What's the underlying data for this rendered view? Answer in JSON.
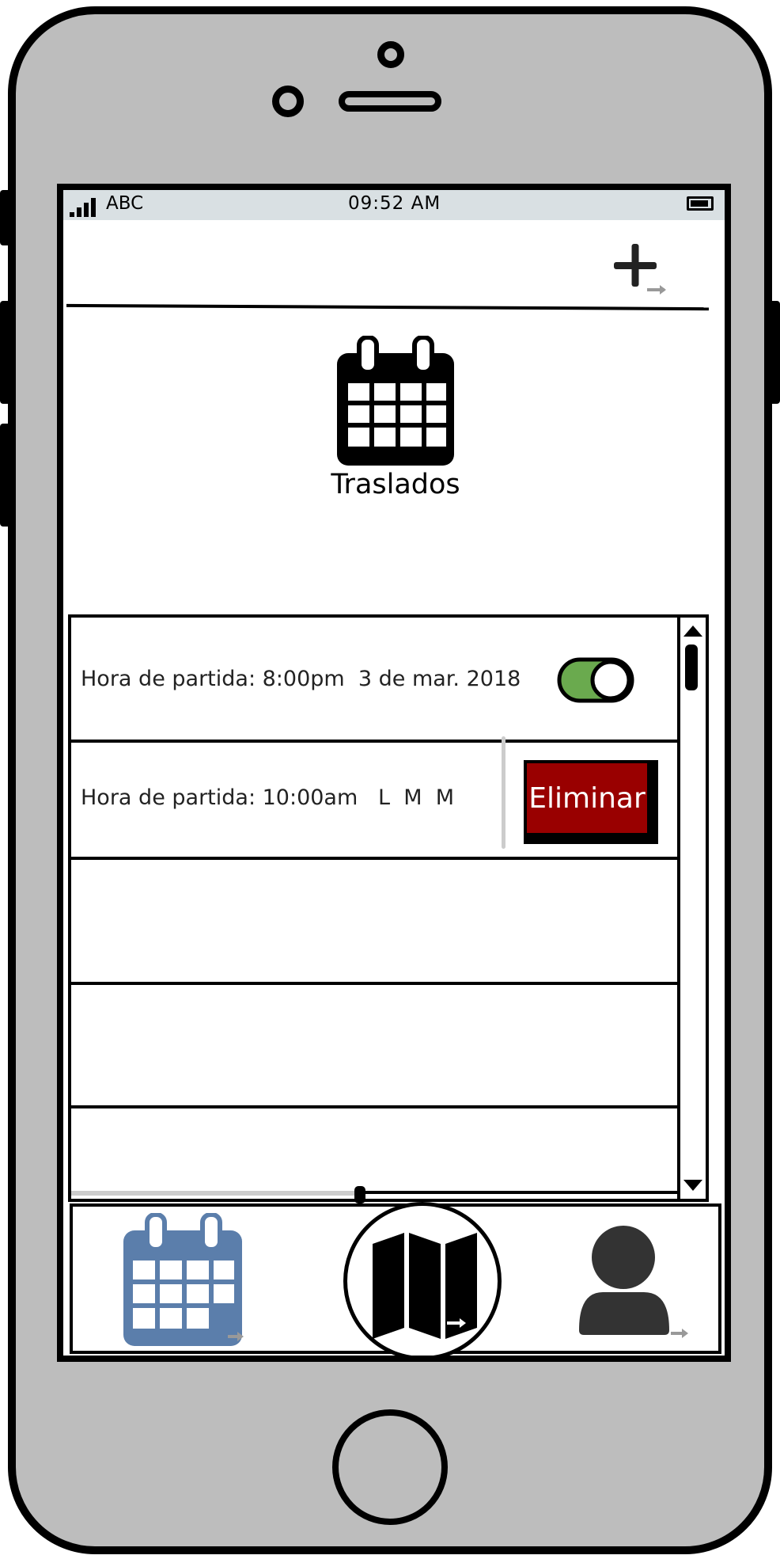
{
  "status_bar": {
    "carrier": "ABC",
    "time": "09:52 AM"
  },
  "header": {
    "add_icon": "plus-icon"
  },
  "page": {
    "title": "Traslados",
    "icon": "calendar-icon"
  },
  "list": {
    "rows": [
      {
        "text": "Hora de partida: 8:00pm  3 de mar. 2018",
        "toggle_on": true
      },
      {
        "text": "Hora de partida: 10:00am   L  M  M",
        "action_label": "Eliminar"
      },
      {
        "text": ""
      },
      {
        "text": ""
      },
      {
        "text": ""
      }
    ]
  },
  "tabbar": {
    "items": [
      {
        "icon": "calendar-icon",
        "active": true
      },
      {
        "icon": "map-icon"
      },
      {
        "icon": "user-icon"
      }
    ]
  },
  "colors": {
    "accent_blue": "#5b7eab",
    "toggle_green": "#6aaa4e",
    "delete_red": "#990000"
  }
}
